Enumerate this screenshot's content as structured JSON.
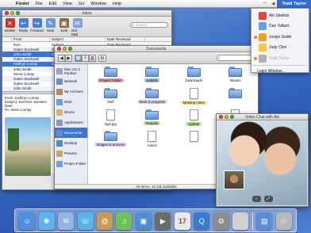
{
  "menubar": {
    "apple": "",
    "items": [
      "Finder",
      "File",
      "Edit",
      "View",
      "Go",
      "Window",
      "Help"
    ],
    "user": "Todd Taylor"
  },
  "mail": {
    "title": "Inbox",
    "toolbar": [
      "Delete",
      "Reply",
      "Forward",
      "New",
      "Junk",
      "Get Mail"
    ],
    "toolbar_icons": [
      "delete-icon",
      "reply-icon",
      "forward-icon",
      "new-message-icon",
      "junk-icon",
      "get-mail-icon"
    ],
    "search_placeholder": "Search",
    "columns": [
      "",
      "From",
      "Subject",
      "Date Received"
    ],
    "rows": [
      {
        "from": "Item",
        "subject": "Subject",
        "date": "Date Received",
        "selected": false
      },
      {
        "from": "Galen Stockwell",
        "subject": "Greetings",
        "date": "Yesterday",
        "selected": false
      },
      {
        "from": "John Smith",
        "subject": "Schedule",
        "date": "Yesterday",
        "selected": true
      },
      {
        "from": "Galen Stockwell",
        "subject": "",
        "date": "",
        "selected": false
      },
      {
        "from": "Kathryn Lomay",
        "subject": "Summer Vacation",
        "date": "",
        "selected": true
      },
      {
        "from": "John Smith",
        "subject": "",
        "date": "",
        "selected": false
      },
      {
        "from": "Steve Lomay",
        "subject": "",
        "date": "",
        "selected": false
      },
      {
        "from": "Galen Stockwell",
        "subject": "",
        "date": "",
        "selected": false
      },
      {
        "from": "Galen Stockwell",
        "subject": "",
        "date": "",
        "selected": false
      },
      {
        "from": "John Smith",
        "subject": "",
        "date": "",
        "selected": false
      }
    ],
    "message": {
      "from": "From: Kathryn Lomay",
      "subject": "Subject: Summer Vacation",
      "date": "Date:",
      "to": "To: Steve Lomay"
    }
  },
  "finder": {
    "title": "Documents",
    "toolbar_icons": [
      "back-icon",
      "forward-icon",
      "icon-view-icon",
      "list-view-icon",
      "column-view-icon",
      "action-gear-icon"
    ],
    "sidebar": [
      {
        "label": "Mac OS X Panther",
        "icon": "hard-disk-icon",
        "selected": false
      },
      {
        "label": "Network",
        "icon": "network-icon",
        "selected": false
      },
      {
        "label": "My Archives",
        "icon": "archive-icon",
        "selected": false
      },
      {
        "label": "iDisk",
        "icon": "idisk-icon",
        "selected": false
      },
      {
        "label": "ktlomo",
        "icon": "home-icon",
        "selected": false
      },
      {
        "label": "Applications",
        "icon": "applications-icon",
        "selected": false
      },
      {
        "label": "Documents",
        "icon": "documents-icon",
        "selected": true
      },
      {
        "label": "Desktop",
        "icon": "desktop-icon",
        "selected": false
      },
      {
        "label": "Pictures",
        "icon": "pictures-icon",
        "selected": false
      },
      {
        "label": "Project Folder",
        "icon": "folder-icon",
        "selected": false
      }
    ],
    "items": [
      {
        "label": "Project Folder",
        "kind": "folder",
        "tag": "#f29aa8"
      },
      {
        "label": "Letters",
        "kind": "folder",
        "tag": "#8fb9ef"
      },
      {
        "label": "Downloads",
        "kind": "folder",
        "tag": ""
      },
      {
        "label": "Movies",
        "kind": "folder",
        "tag": ""
      },
      {
        "label": "Stuff",
        "kind": "folder",
        "tag": ""
      },
      {
        "label": "Work in progress",
        "kind": "folder",
        "tag": "#d9cff0"
      },
      {
        "label": "Meeting notes",
        "kind": "doc",
        "tag": "#f4e47a"
      },
      {
        "label": "",
        "kind": "folder",
        "tag": ""
      },
      {
        "label": "logo.jpg",
        "kind": "doc",
        "tag": ""
      },
      {
        "label": "Reports",
        "kind": "folder",
        "tag": "#b3e08f"
      },
      {
        "label": "Update",
        "kind": "doc",
        "tag": "#b3e08f"
      },
      {
        "label": "",
        "kind": "doc",
        "tag": ""
      },
      {
        "label": "Images to process",
        "kind": "folder",
        "tag": "#d9cff0"
      },
      {
        "label": "Admin",
        "kind": "doc",
        "tag": ""
      },
      {
        "label": "",
        "kind": "doc",
        "tag": ""
      },
      {
        "label": "",
        "kind": "doc",
        "tag": ""
      }
    ],
    "status": "25 items, 15 GB available"
  },
  "ichat": {
    "title": "Video Chat with Aki",
    "controls": [
      "mute-icon",
      "fullscreen-icon"
    ]
  },
  "usermenu": {
    "users": [
      {
        "name": "Aki Shelton",
        "color": "#e0443c",
        "logged_in": false,
        "dim": false
      },
      {
        "name": "Dan Talbert",
        "color": "#6aa0d8",
        "logged_in": false,
        "dim": false
      },
      {
        "name": "Joslyn Smith",
        "color": "#f0a020",
        "logged_in": true,
        "dim": false
      },
      {
        "name": "Judy Chin",
        "color": "#f6c640",
        "logged_in": false,
        "dim": false
      },
      {
        "name": "Todd Taylor",
        "color": "#b0b0b0",
        "logged_in": true,
        "dim": true
      }
    ],
    "login": "Login Window..."
  },
  "dock": [
    {
      "name": "finder-icon",
      "color": "#4e8fe0"
    },
    {
      "name": "safari-icon",
      "color": "#5bb3f0"
    },
    {
      "name": "mail-icon",
      "color": "#8fb6e6"
    },
    {
      "name": "ichat-icon",
      "color": "#58b4e8"
    },
    {
      "name": "address-book-icon",
      "color": "#c79a56"
    },
    {
      "name": "itunes-icon",
      "color": "#6cc35a"
    },
    {
      "name": "iphoto-icon",
      "color": "#4f8fcf"
    },
    {
      "name": "imovie-icon",
      "color": "#6c6c6c"
    },
    {
      "name": "ical-icon",
      "color": "#e9e9e9"
    },
    {
      "name": "quicktime-icon",
      "color": "#3a7ad0"
    },
    {
      "name": "system-preferences-icon",
      "color": "#8c8c8c"
    },
    {
      "name": "apple-icon",
      "color": "#d0d0d0"
    },
    {
      "name": "spacer",
      "color": "transparent"
    },
    {
      "name": "documents-stack-icon",
      "color": "#5a8ed8"
    },
    {
      "name": "trash-icon",
      "color": "#b8b8b8"
    }
  ],
  "dock_labels": {
    "ical": "17"
  }
}
